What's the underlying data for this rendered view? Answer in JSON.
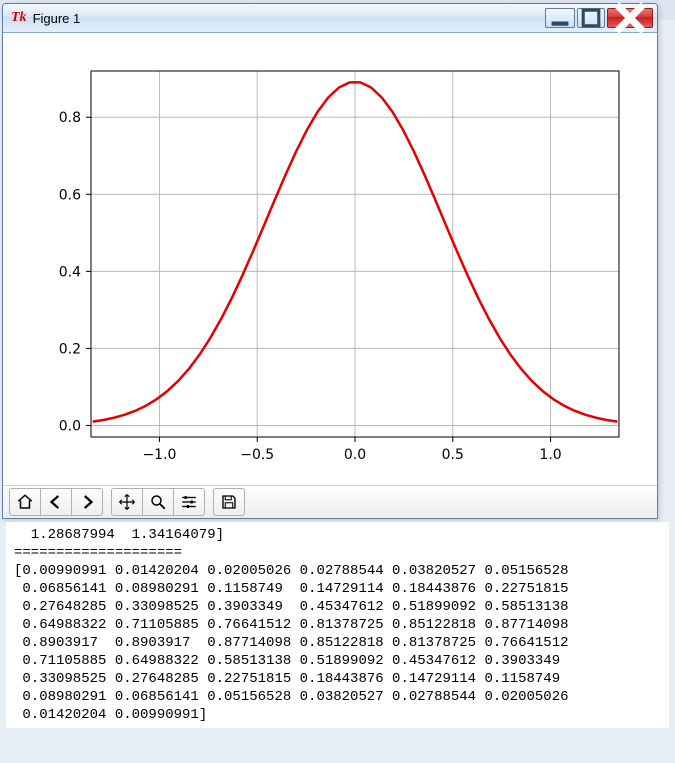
{
  "window": {
    "tk_logo": "Tk",
    "title": "Figure 1",
    "buttons": {
      "min": "–",
      "max": "❐",
      "close": "×"
    }
  },
  "toolbar": {
    "home": "home-icon",
    "back": "back-icon",
    "forward": "forward-icon",
    "pan": "pan-icon",
    "zoom": "zoom-icon",
    "configure": "configure-icon",
    "save": "save-icon"
  },
  "chart_data": {
    "type": "line",
    "xlabel": "",
    "ylabel": "",
    "title": "",
    "xlim": [
      -1.35,
      1.35
    ],
    "ylim": [
      -0.03,
      0.92
    ],
    "xticks": [
      -1.0,
      -0.5,
      0.0,
      0.5,
      1.0
    ],
    "yticks": [
      0.0,
      0.2,
      0.4,
      0.6,
      0.8
    ],
    "x": [
      -1.34164079,
      -1.28687994,
      -1.23211909,
      -1.17735824,
      -1.12259739,
      -1.06783654,
      -1.01307569,
      -0.95831484,
      -0.90355399,
      -0.84879314,
      -0.79403229,
      -0.73927144,
      -0.68451059,
      -0.62974974,
      -0.57498889,
      -0.52022804,
      -0.46546719,
      -0.41070634,
      -0.35594549,
      -0.30118464,
      -0.24642379,
      -0.19166294,
      -0.13690209,
      -0.08214124,
      -0.02738039,
      0.02738039,
      0.08214124,
      0.13690209,
      0.19166294,
      0.24642379,
      0.30118464,
      0.35594549,
      0.41070634,
      0.46546719,
      0.52022804,
      0.57498889,
      0.62974974,
      0.68451059,
      0.73927144,
      0.79403229,
      0.84879314,
      0.90355399,
      0.95831484,
      1.01307569,
      1.06783654,
      1.12259739,
      1.17735824,
      1.23211909,
      1.28687994,
      1.34164079
    ],
    "y": [
      0.00990991,
      0.01420204,
      0.02005026,
      0.02788544,
      0.03820527,
      0.05156528,
      0.06856141,
      0.08980291,
      0.1158749,
      0.14729114,
      0.18443876,
      0.22751815,
      0.27648285,
      0.33098525,
      0.3903349,
      0.45347612,
      0.51899092,
      0.58513138,
      0.64988322,
      0.71105885,
      0.76641512,
      0.81378725,
      0.85122818,
      0.87714098,
      0.8903917,
      0.8903917,
      0.87714098,
      0.85122818,
      0.81378725,
      0.76641512,
      0.71105885,
      0.64988322,
      0.58513138,
      0.51899092,
      0.45347612,
      0.3903349,
      0.33098525,
      0.27648285,
      0.22751815,
      0.18443876,
      0.14729114,
      0.1158749,
      0.08980291,
      0.06856141,
      0.05156528,
      0.03820527,
      0.02788544,
      0.02005026,
      0.01420204,
      0.00990991
    ],
    "color": "#e40000",
    "linewidth": 2.5
  },
  "console_lines": [
    "  1.28687994  1.34164079]",
    "====================",
    "[0.00990991 0.01420204 0.02005026 0.02788544 0.03820527 0.05156528",
    " 0.06856141 0.08980291 0.1158749  0.14729114 0.18443876 0.22751815",
    " 0.27648285 0.33098525 0.3903349  0.45347612 0.51899092 0.58513138",
    " 0.64988322 0.71105885 0.76641512 0.81378725 0.85122818 0.87714098",
    " 0.8903917  0.8903917  0.87714098 0.85122818 0.81378725 0.76641512",
    " 0.71105885 0.64988322 0.58513138 0.51899092 0.45347612 0.3903349",
    " 0.33098525 0.27648285 0.22751815 0.18443876 0.14729114 0.1158749",
    " 0.08980291 0.06856141 0.05156528 0.03820527 0.02788544 0.02005026",
    " 0.01420204 0.00990991]"
  ]
}
